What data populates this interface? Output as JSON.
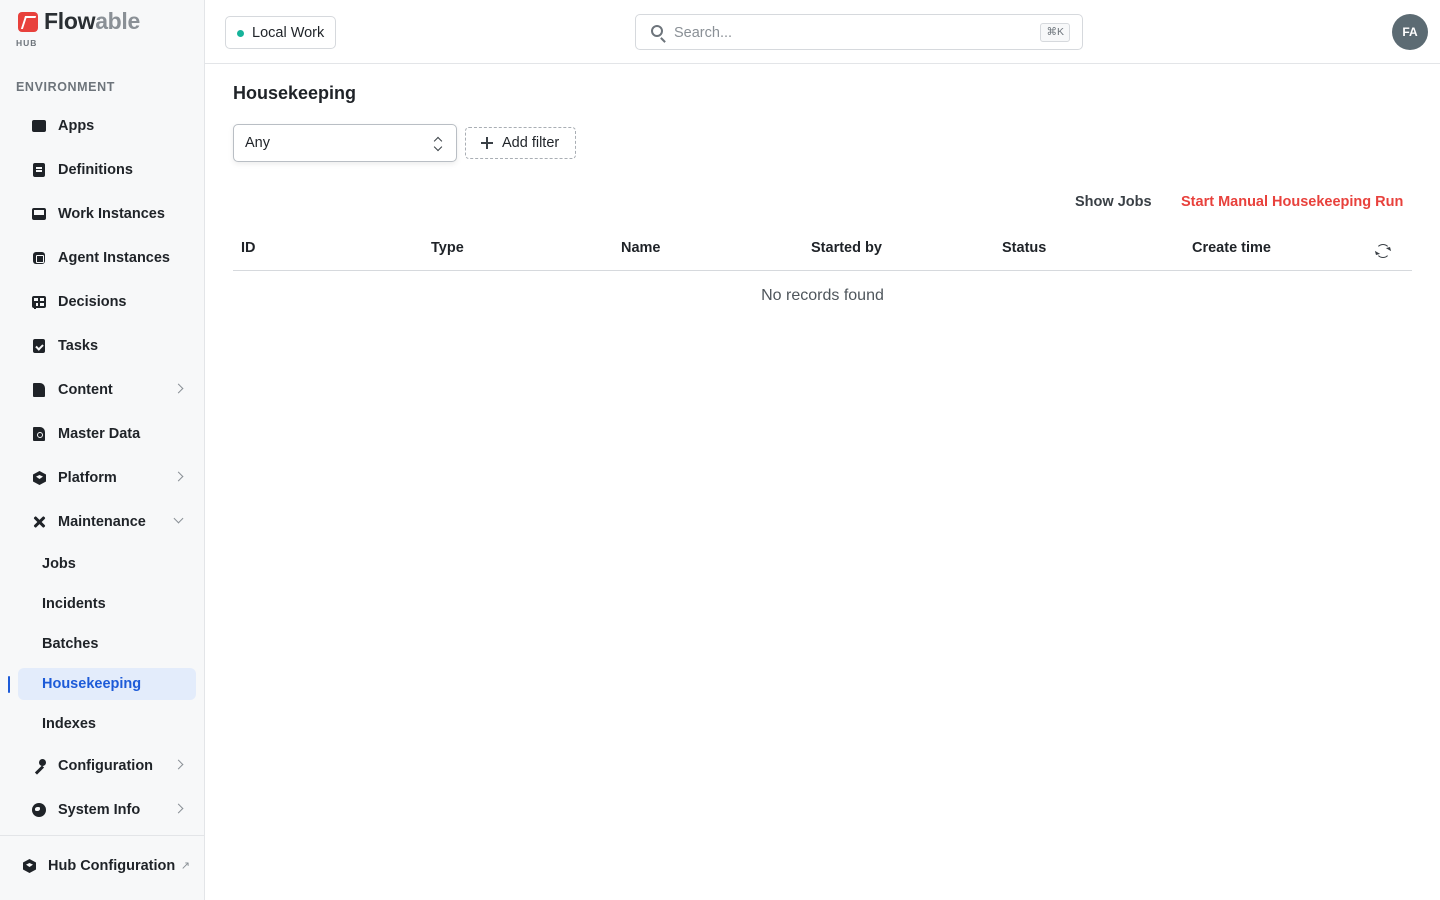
{
  "logo": {
    "flow": "Flow",
    "able": "able",
    "sub": "HUB"
  },
  "sidebar": {
    "section_label": "ENVIRONMENT",
    "items": [
      {
        "label": "Apps"
      },
      {
        "label": "Definitions"
      },
      {
        "label": "Work Instances"
      },
      {
        "label": "Agent Instances"
      },
      {
        "label": "Decisions"
      },
      {
        "label": "Tasks"
      },
      {
        "label": "Content"
      },
      {
        "label": "Master Data"
      },
      {
        "label": "Platform"
      },
      {
        "label": "Maintenance"
      },
      {
        "label": "Configuration"
      },
      {
        "label": "System Info"
      }
    ],
    "maintenance_sub": [
      {
        "label": "Jobs"
      },
      {
        "label": "Incidents"
      },
      {
        "label": "Batches"
      },
      {
        "label": "Housekeeping"
      },
      {
        "label": "Indexes"
      }
    ],
    "active_item": "Housekeeping",
    "footer_label": "Hub Configuration"
  },
  "topbar": {
    "workspace_label": "Local Work",
    "workspace_status_color": "#16b39a",
    "search_placeholder": "Search...",
    "search_shortcut": "⌘K",
    "avatar_initials": "FA"
  },
  "main": {
    "title": "Housekeeping",
    "filter_select_value": "Any",
    "add_filter_label": "Add filter",
    "show_jobs_label": "Show Jobs",
    "start_run_label": "Start Manual Housekeeping Run",
    "columns": [
      "ID",
      "Type",
      "Name",
      "Started by",
      "Status",
      "Create time"
    ],
    "empty_message": "No records found"
  },
  "colors": {
    "accent": "#1d5bd8",
    "danger": "#e8413c",
    "brand": "#e8413c"
  }
}
